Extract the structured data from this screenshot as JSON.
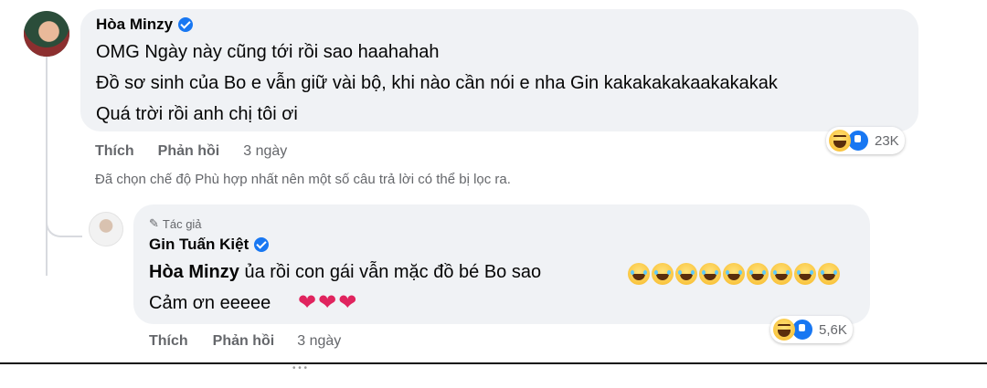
{
  "comment": {
    "author": "Hòa Minzy",
    "lines": [
      "OMG Ngày này cũng tới rồi sao haahahah",
      "Đồ sơ sinh của Bo e vẫn giữ vài bộ, khi nào cần nói e nha Gin kakakakakaakakakak",
      "Quá trời rồi anh chị tôi ơi"
    ],
    "like_label": "Thích",
    "reply_label": "Phản hồi",
    "time": "3 ngày",
    "reaction_count": "23K"
  },
  "filter_note": "Đã chọn chế độ Phù hợp nhất nên một số câu trả lời có thể bị lọc ra.",
  "reply": {
    "author_tag": "Tác giả",
    "author": "Gin Tuấn Kiệt",
    "mention": "Hòa Minzy",
    "text_after_mention": " ủa rồi con gái vẫn mặc đồ bé Bo sao",
    "line2": "Cảm ơn eeeee",
    "like_label": "Thích",
    "reply_label": "Phản hồi",
    "time": "3 ngày",
    "reaction_count": "5,6K"
  }
}
